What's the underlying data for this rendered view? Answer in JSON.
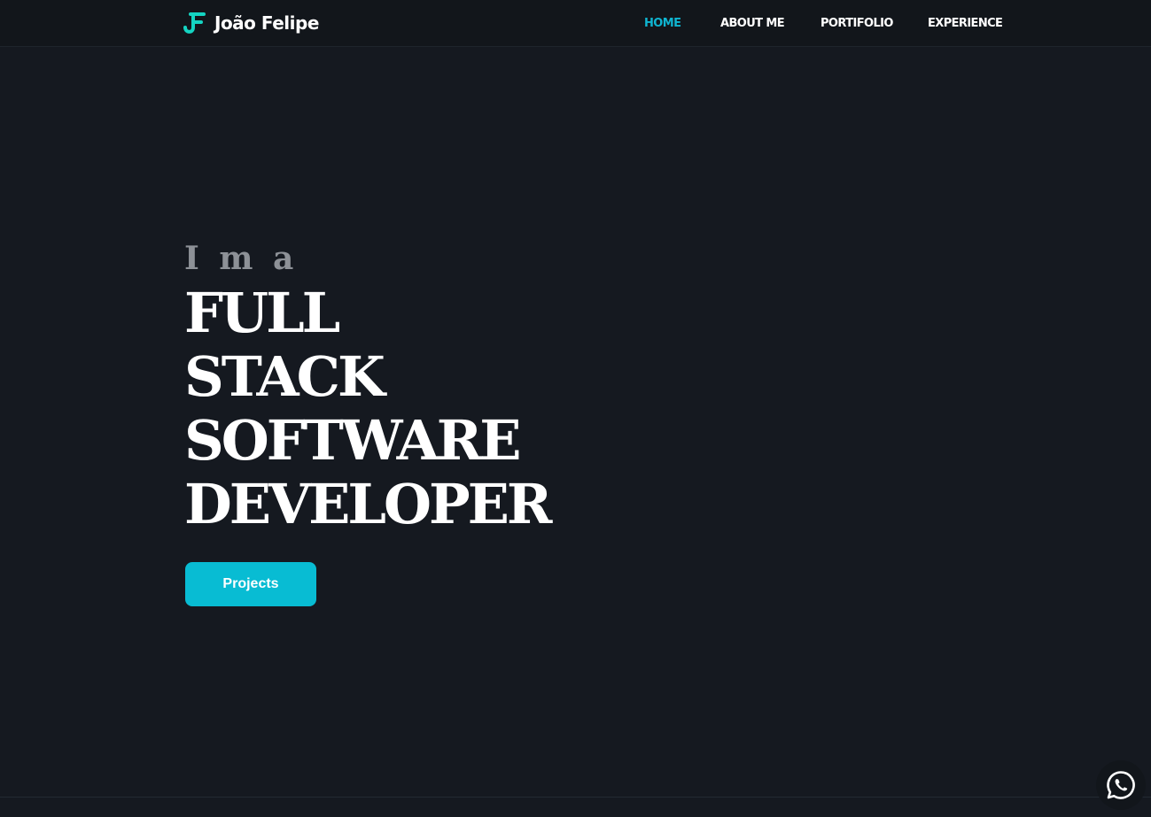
{
  "brand": {
    "logo_icon": "jf-monogram-icon",
    "name": "João Felipe",
    "accent_color": "#14d4c2"
  },
  "nav": {
    "items": [
      {
        "label": "HOME",
        "active": true
      },
      {
        "label": "ABOUT ME",
        "active": false
      },
      {
        "label": "PORTIFOLIO",
        "active": false
      },
      {
        "label": "EXPERIENCE",
        "active": false
      }
    ],
    "active_color": "#0fb5d1"
  },
  "hero": {
    "pre": "I m a",
    "title_lines": [
      "FULL",
      "STACK",
      "SOFTWARE",
      "DEVELOPER"
    ],
    "cta_label": "Projects",
    "cta_color": "#08bcd3"
  },
  "fab": {
    "icon": "whatsapp-icon"
  }
}
